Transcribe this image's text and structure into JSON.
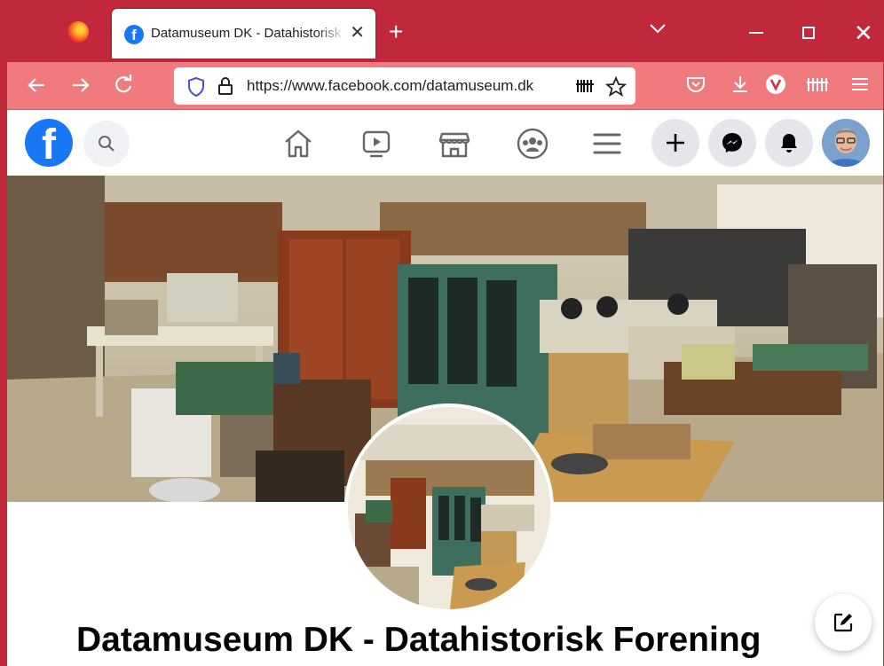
{
  "browser": {
    "tab_title": "Datamuseum DK - Datahistorisk Forening",
    "tab_close": "✕",
    "new_tab": "+",
    "url": "https://www.facebook.com/datamuseum.dk",
    "window_close": "✕"
  },
  "facebook": {
    "logo_letter": "f",
    "page_name": "Datamuseum DK - Datahistorisk Forening"
  },
  "colors": {
    "tabbar": "#c2283c",
    "navbar": "#f17a7f",
    "facebook_blue": "#1877f2"
  },
  "icons": [
    "firefox-icon",
    "facebook-icon",
    "back-icon",
    "forward-icon",
    "reload-icon",
    "shield-icon",
    "lock-icon",
    "barcode-icon",
    "star-icon",
    "pocket-icon",
    "download-icon",
    "vivaldi-icon",
    "extension-icon",
    "menu-icon",
    "search-icon",
    "home-icon",
    "video-icon",
    "marketplace-icon",
    "groups-icon",
    "plus-icon",
    "messenger-icon",
    "bell-icon",
    "edit-icon"
  ]
}
